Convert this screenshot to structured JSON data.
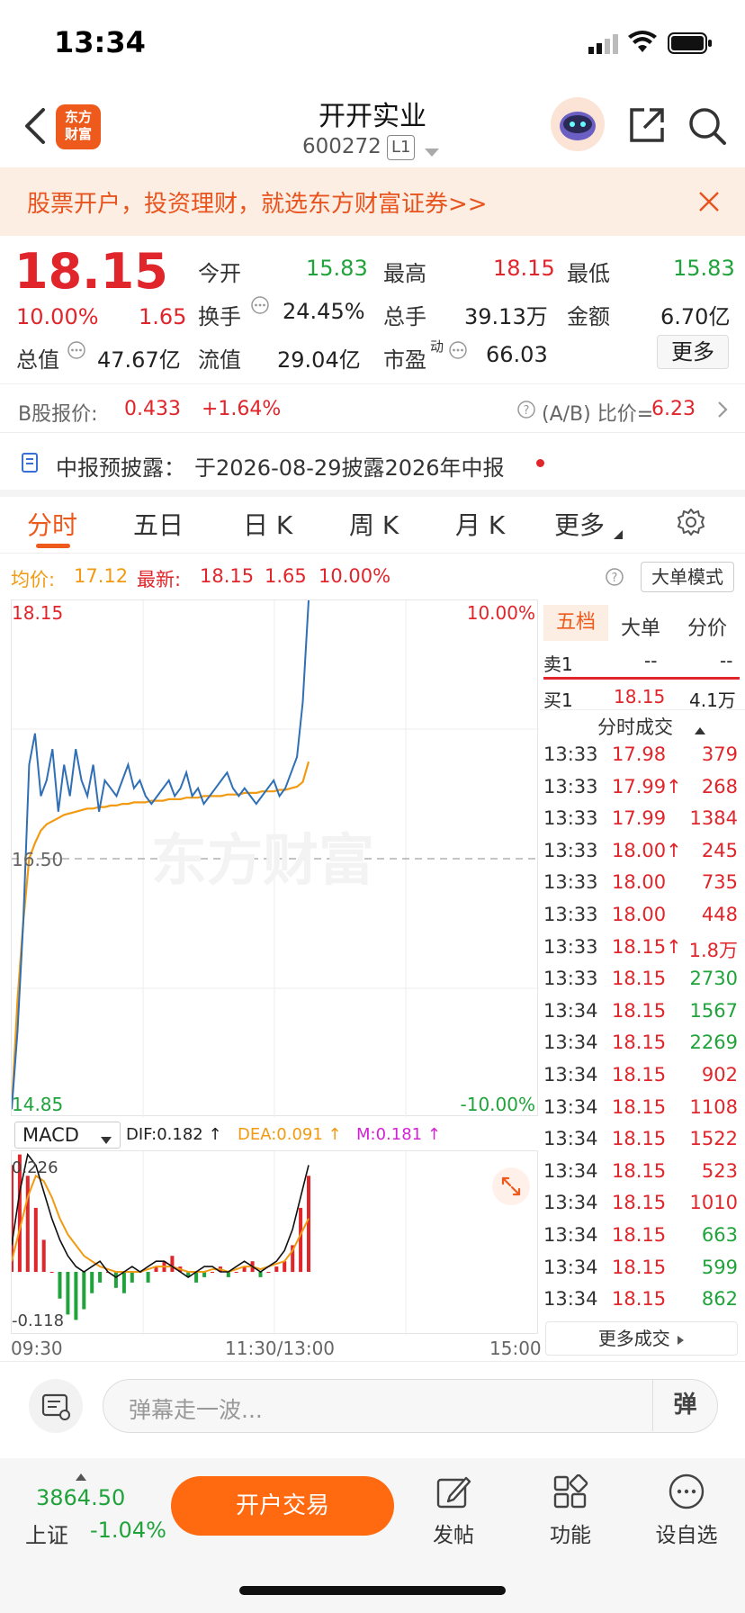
{
  "status": {
    "time": "13:34"
  },
  "header": {
    "title": "开开实业",
    "code": "600272",
    "level": "L1",
    "logo_text_1": "东方",
    "logo_text_2": "财富"
  },
  "promo": {
    "text": "股票开户，投资理财，就选东方财富证券>>"
  },
  "quote": {
    "price": "18.15",
    "pct": "10.00%",
    "change": "1.65",
    "open_label": "今开",
    "open": "15.83",
    "high_label": "最高",
    "high": "18.15",
    "low_label": "最低",
    "low": "15.83",
    "turnover_label": "换手",
    "turnover": "24.45%",
    "volume_label": "总手",
    "volume": "39.13万",
    "amount_label": "金额",
    "amount": "6.70亿",
    "mktcap_label": "总值",
    "mktcap": "47.67亿",
    "float_label": "流值",
    "float": "29.04亿",
    "pe_label": "市盈",
    "pe_sup": "动",
    "pe": "66.03",
    "more": "更多"
  },
  "bshare": {
    "label": "B股报价:",
    "price": "0.433",
    "pct": "+1.64%",
    "ratio_label": "(A/B) 比价=",
    "ratio": "6.23"
  },
  "notice": {
    "label": "中报预披露：",
    "text": "于2026-08-29披露2026年中报"
  },
  "tabs": [
    "分时",
    "五日",
    "日 K",
    "周 K",
    "月 K",
    "更多"
  ],
  "chart_header": {
    "avg_label": "均价:",
    "avg": "17.12",
    "latest_label": "最新:",
    "latest": "18.15",
    "chg": "1.65",
    "pct": "10.00%",
    "mode_btn": "大单模式"
  },
  "chart_data": {
    "type": "line",
    "ylim": [
      14.85,
      18.15
    ],
    "ytick_top": "18.15",
    "ytick_mid": "16.50",
    "ytick_bottom": "14.85",
    "ptick_top": "10.00%",
    "ptick_bottom": "-10.00%",
    "x_labels": [
      "09:30",
      "11:30/13:00",
      "15:00"
    ],
    "watermark": "东方财富",
    "price_series": [
      14.9,
      15.4,
      16.1,
      17.1,
      17.3,
      16.9,
      17.0,
      17.2,
      16.8,
      17.1,
      16.9,
      17.2,
      17.0,
      16.9,
      17.1,
      16.8,
      17.0,
      16.95,
      16.9,
      17.0,
      17.1,
      16.95,
      17.0,
      16.9,
      16.85,
      16.9,
      16.95,
      17.0,
      16.9,
      16.95,
      17.05,
      16.9,
      16.95,
      16.85,
      16.9,
      16.95,
      17.0,
      17.05,
      16.95,
      16.9,
      16.95,
      16.9,
      16.85,
      16.9,
      16.95,
      17.0,
      16.9,
      16.95,
      17.05,
      17.15,
      17.5,
      18.15
    ],
    "avg_series": [
      14.9,
      15.6,
      16.1,
      16.5,
      16.6,
      16.68,
      16.72,
      16.74,
      16.76,
      16.78,
      16.79,
      16.8,
      16.81,
      16.82,
      16.82,
      16.83,
      16.83,
      16.84,
      16.84,
      16.85,
      16.85,
      16.86,
      16.86,
      16.86,
      16.87,
      16.87,
      16.87,
      16.88,
      16.88,
      16.88,
      16.89,
      16.89,
      16.89,
      16.9,
      16.9,
      16.9,
      16.9,
      16.91,
      16.91,
      16.91,
      16.92,
      16.92,
      16.92,
      16.93,
      16.93,
      16.93,
      16.94,
      16.94,
      16.95,
      16.96,
      16.99,
      17.12
    ]
  },
  "macd": {
    "selector": "MACD",
    "dif_label": "DIF:0.182 ↑",
    "dea_label": "DEA:0.091 ↑",
    "m_label": "M:0.181 ↑",
    "top": "0.226",
    "bottom": "-0.118",
    "hist": [
      0.2,
      0.22,
      0.18,
      0.12,
      0.06,
      0.0,
      -0.05,
      -0.08,
      -0.09,
      -0.07,
      -0.04,
      -0.02,
      0.0,
      -0.03,
      -0.04,
      -0.02,
      0.0,
      -0.02,
      0.01,
      0.02,
      0.03,
      0.01,
      -0.01,
      -0.02,
      -0.01,
      0.0,
      0.01,
      -0.01,
      0.0,
      0.01,
      0.02,
      -0.01,
      0.0,
      0.01,
      0.02,
      0.05,
      0.12,
      0.18
    ],
    "dif": [
      0.05,
      0.15,
      0.22,
      0.2,
      0.15,
      0.1,
      0.06,
      0.03,
      0.01,
      0.0,
      0.01,
      0.02,
      0.0,
      -0.01,
      0.0,
      0.01,
      0.0,
      0.01,
      0.02,
      0.02,
      0.01,
      0.0,
      -0.01,
      0.0,
      0.01,
      0.01,
      0.0,
      0.0,
      0.01,
      0.02,
      0.01,
      0.0,
      0.01,
      0.02,
      0.04,
      0.08,
      0.14,
      0.2
    ],
    "dea": [
      0.02,
      0.08,
      0.14,
      0.18,
      0.17,
      0.14,
      0.1,
      0.07,
      0.05,
      0.03,
      0.02,
      0.01,
      0.005,
      0.0,
      0.0,
      0.0,
      0.0,
      0.005,
      0.01,
      0.01,
      0.01,
      0.005,
      0.0,
      0.0,
      0.0,
      0.005,
      0.005,
      0.0,
      0.005,
      0.01,
      0.01,
      0.005,
      0.01,
      0.015,
      0.02,
      0.04,
      0.07,
      0.1
    ]
  },
  "panel": {
    "tabs": [
      "五档",
      "大单",
      "分价"
    ],
    "sell1_label": "卖1",
    "sell1_price": "--",
    "sell1_vol": "--",
    "buy1_label": "买1",
    "buy1_price": "18.15",
    "buy1_vol": "4.1万",
    "ticks_title": "分时成交",
    "ticks": [
      {
        "time": "13:33",
        "price": "17.98",
        "vol": "379",
        "dir": "red"
      },
      {
        "time": "13:33",
        "price": "17.99↑",
        "vol": "268",
        "dir": "red"
      },
      {
        "time": "13:33",
        "price": "17.99",
        "vol": "1384",
        "dir": "red"
      },
      {
        "time": "13:33",
        "price": "18.00↑",
        "vol": "245",
        "dir": "red"
      },
      {
        "time": "13:33",
        "price": "18.00",
        "vol": "735",
        "dir": "red"
      },
      {
        "time": "13:33",
        "price": "18.00",
        "vol": "448",
        "dir": "red"
      },
      {
        "time": "13:33",
        "price": "18.15↑",
        "vol": "1.8万",
        "dir": "red"
      },
      {
        "time": "13:33",
        "price": "18.15",
        "vol": "2730",
        "dir": "green"
      },
      {
        "time": "13:34",
        "price": "18.15",
        "vol": "1567",
        "dir": "green"
      },
      {
        "time": "13:34",
        "price": "18.15",
        "vol": "2269",
        "dir": "green"
      },
      {
        "time": "13:34",
        "price": "18.15",
        "vol": "902",
        "dir": "red"
      },
      {
        "time": "13:34",
        "price": "18.15",
        "vol": "1108",
        "dir": "red"
      },
      {
        "time": "13:34",
        "price": "18.15",
        "vol": "1522",
        "dir": "red"
      },
      {
        "time": "13:34",
        "price": "18.15",
        "vol": "523",
        "dir": "red"
      },
      {
        "time": "13:34",
        "price": "18.15",
        "vol": "1010",
        "dir": "red"
      },
      {
        "time": "13:34",
        "price": "18.15",
        "vol": "663",
        "dir": "green"
      },
      {
        "time": "13:34",
        "price": "18.15",
        "vol": "599",
        "dir": "green"
      },
      {
        "time": "13:34",
        "price": "18.15",
        "vol": "862",
        "dir": "green"
      }
    ],
    "more_ticks": "更多成交"
  },
  "danmu": {
    "placeholder": "弹幕走一波...",
    "send": "弹"
  },
  "bottom": {
    "index_value": "3864.50",
    "index_name": "上证",
    "index_pct": "-1.04%",
    "open_trade": "开户交易",
    "post": "发帖",
    "func": "功能",
    "watch": "设自选"
  },
  "colors": {
    "up": "#e0252b",
    "down": "#1fa33a",
    "accent": "#ff6a10",
    "price_line": "#2f6fb5",
    "avg_line": "#f29a11"
  }
}
